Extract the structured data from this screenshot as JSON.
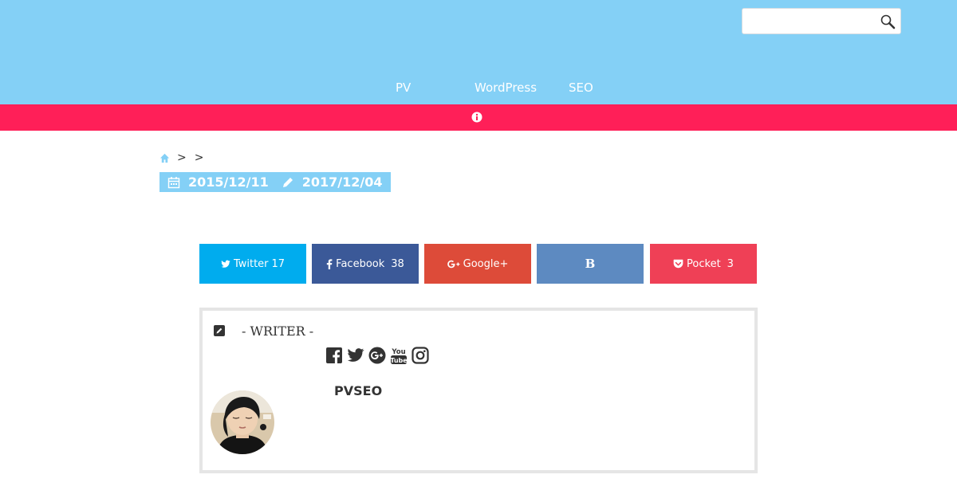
{
  "header": {
    "search": {
      "value": "",
      "placeholder": ""
    },
    "nav": [
      "PV",
      "WordPress",
      "SEO"
    ],
    "colors": {
      "header": "#84d0f6",
      "notice": "#ff1f58"
    }
  },
  "notice": {
    "icon": "info-icon"
  },
  "breadcrumb": {
    "separators": [
      ">",
      ">"
    ]
  },
  "dates": {
    "published": "2015/12/11",
    "updated": "2017/12/04"
  },
  "share": {
    "twitter": {
      "label": "Twitter",
      "count": "17",
      "color": "#00acee"
    },
    "facebook": {
      "label": "Facebook",
      "count": "38",
      "color": "#3b5998"
    },
    "googleplus": {
      "label": "Google+",
      "count": "",
      "color": "#dd4b39"
    },
    "hatena": {
      "label": "B",
      "count": "",
      "color": "#5d8ac1"
    },
    "pocket": {
      "label": "Pocket",
      "count": "3",
      "color": "#ef4056"
    }
  },
  "writer": {
    "label": "- WRITER -",
    "name": "PVSEO",
    "socials": [
      "facebook-icon",
      "twitter-icon",
      "google-plus-icon",
      "youtube-icon",
      "instagram-icon"
    ]
  }
}
